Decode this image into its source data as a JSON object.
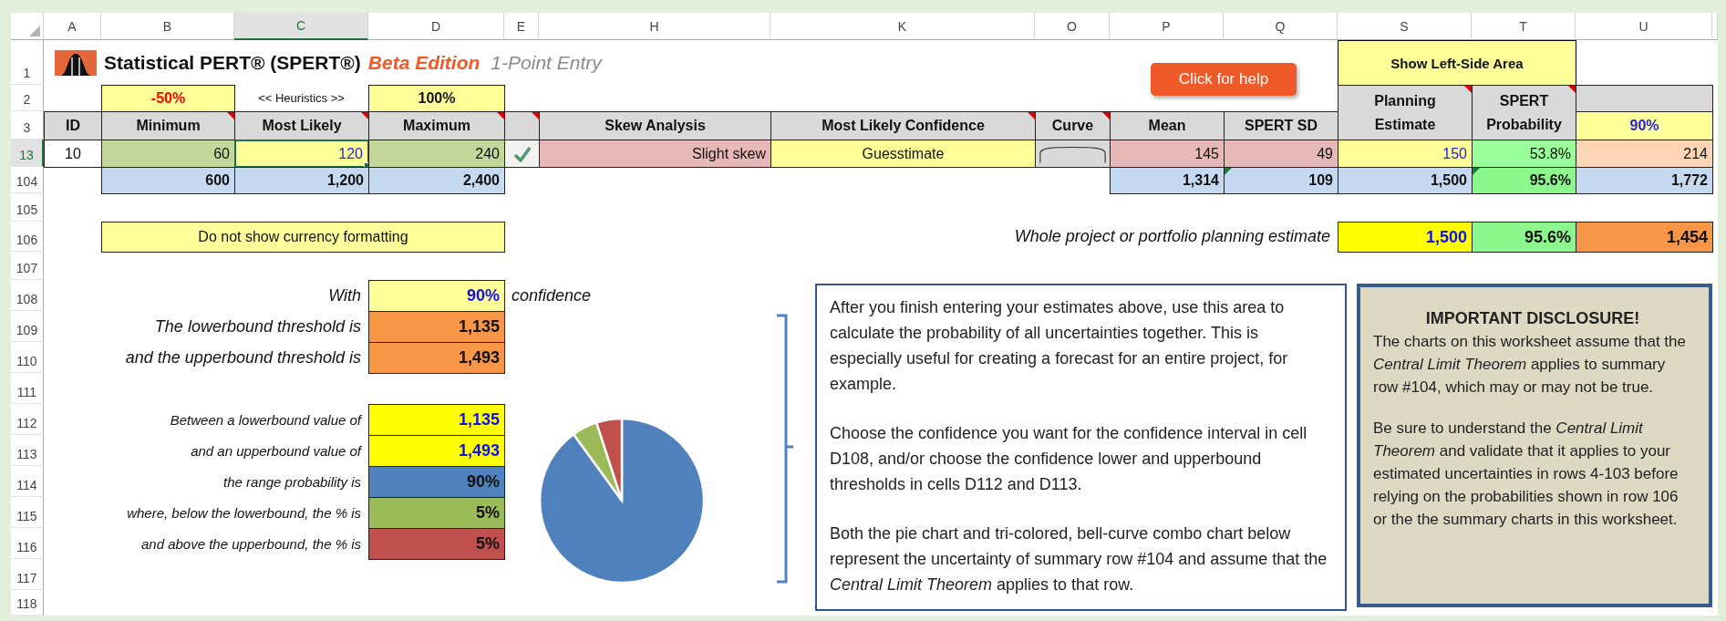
{
  "column_headers": [
    {
      "label": "A",
      "selected": false
    },
    {
      "label": "B",
      "selected": false
    },
    {
      "label": "C",
      "selected": true
    },
    {
      "label": "D",
      "selected": false
    },
    {
      "label": "E",
      "selected": false
    },
    {
      "label": "H",
      "selected": false
    },
    {
      "label": "K",
      "selected": false
    },
    {
      "label": "O",
      "selected": false
    },
    {
      "label": "P",
      "selected": false
    },
    {
      "label": "Q",
      "selected": false
    },
    {
      "label": "S",
      "selected": false
    },
    {
      "label": "T",
      "selected": false
    },
    {
      "label": "U",
      "selected": false
    }
  ],
  "row_headers": [
    {
      "label": "1",
      "selected": false
    },
    {
      "label": "2",
      "selected": false
    },
    {
      "label": "3",
      "selected": false
    },
    {
      "label": "13",
      "selected": true
    },
    {
      "label": "104",
      "selected": false
    },
    {
      "label": "105",
      "selected": false
    },
    {
      "label": "106",
      "selected": false
    },
    {
      "label": "107",
      "selected": false
    },
    {
      "label": "108",
      "selected": false
    },
    {
      "label": "109",
      "selected": false
    },
    {
      "label": "110",
      "selected": false
    },
    {
      "label": "111",
      "selected": false
    },
    {
      "label": "112",
      "selected": false
    },
    {
      "label": "113",
      "selected": false
    },
    {
      "label": "114",
      "selected": false
    },
    {
      "label": "115",
      "selected": false
    },
    {
      "label": "116",
      "selected": false
    },
    {
      "label": "117",
      "selected": false
    },
    {
      "label": "118",
      "selected": false
    }
  ],
  "title": {
    "name": "Statistical PERT® (SPERT®)",
    "edition": "Beta Edition",
    "subtitle": "1-Point Entry"
  },
  "help_button": "Click for help",
  "show_left_button": "Show Left-Side Area",
  "heuristics": {
    "low": "-50%",
    "label": "<< Heuristics >>",
    "high": "100%"
  },
  "headers": [
    {
      "label": "ID",
      "kind": "header",
      "comment": false
    },
    {
      "label": "Minimum",
      "kind": "header",
      "comment": true
    },
    {
      "label": "Most Likely",
      "kind": "header",
      "comment": true
    },
    {
      "label": "Maximum",
      "kind": "header",
      "comment": true
    },
    {
      "kind": "header",
      "comment": true
    },
    {
      "label": "Skew Analysis",
      "kind": "header",
      "comment": false
    },
    {
      "label": "Most Likely Confidence",
      "kind": "header",
      "comment": true
    },
    {
      "label": "Curve",
      "kind": "header",
      "comment": true
    },
    {
      "label": "Mean",
      "kind": "header",
      "comment": false
    },
    {
      "label": "SPERT SD",
      "kind": "header",
      "comment": false
    },
    {
      "label": "Planning Estimate",
      "kind": "tall",
      "comment": true
    },
    {
      "label": "SPERT Probability",
      "kind": "tall",
      "comment": true
    },
    {
      "label": "90%",
      "kind": "input",
      "comment": false
    }
  ],
  "task_row": [
    {
      "kind": "text",
      "text": "10",
      "selected": false
    },
    {
      "kind": "text",
      "text": "60",
      "selected": false
    },
    {
      "kind": "text",
      "text": "120",
      "selected": true
    },
    {
      "kind": "text",
      "text": "240",
      "selected": false
    },
    {
      "kind": "check",
      "selected": false
    },
    {
      "kind": "text",
      "text": "Slight skew",
      "selected": false
    },
    {
      "kind": "text",
      "text": "Guesstimate",
      "selected": false
    },
    {
      "kind": "curve",
      "selected": false
    },
    {
      "kind": "text",
      "text": "145",
      "selected": false
    },
    {
      "kind": "text",
      "text": "49",
      "selected": false
    },
    {
      "kind": "text",
      "text": "150",
      "selected": false
    },
    {
      "kind": "text",
      "text": "53.8%",
      "selected": false
    },
    {
      "kind": "text",
      "text": "214",
      "selected": false
    }
  ],
  "summary_row": [
    {
      "text": "600",
      "warning": false
    },
    {
      "text": "1,200",
      "warning": false
    },
    {
      "text": "2,400",
      "warning": false
    },
    {
      "text": "1,314",
      "warning": false
    },
    {
      "text": "109",
      "warning": true
    },
    {
      "text": "1,500",
      "warning": false
    },
    {
      "text": "95.6%",
      "warning": true
    },
    {
      "text": "1,772",
      "warning": false
    }
  ],
  "currency_toggle": "Do not show currency formatting",
  "whole_project": {
    "label": "Whole project or portfolio planning estimate",
    "cells": [
      "1,500",
      "95.6%",
      "1,454"
    ]
  },
  "confidence": {
    "label": "With",
    "value": "90%",
    "suffix": "confidence"
  },
  "thresholds": [
    {
      "label": "The lowerbound threshold is",
      "value": "1,135"
    },
    {
      "label": "and the upperbound threshold is",
      "value": "1,493"
    }
  ],
  "range_rows": [
    {
      "label": "Between a lowerbound value of",
      "value": "1,135",
      "color": "#ffff00"
    },
    {
      "label": "and an upperbound value of",
      "value": "1,493",
      "color": "#ffff00"
    },
    {
      "label": "the range probability is",
      "value": "90%",
      "color": "#4f81bd"
    },
    {
      "label": "where, below the lowerbound, the % is",
      "value": "5%",
      "color": "#9bbb59"
    },
    {
      "label": "and above the upperbound, the % is",
      "value": "5%",
      "color": "#c0504d"
    }
  ],
  "chart_data": {
    "type": "pie",
    "values": [
      90,
      5,
      5
    ]
  },
  "instructions": [
    "After you finish entering your estimates above, use this area to calculate the probability of all uncertainties together. This is especially useful for creating a forecast for an entire project, for example.",
    "Choose the confidence you want for the confidence interval in cell D108, and/or choose the confidence lower and upperbound thresholds in cells D112 and D113.",
    "Both the pie chart and tri-colored, bell-curve combo chart below represent the uncertainty of summary row #104 and assume that the *Central Limit Theorem* applies to that row."
  ],
  "disclosure": {
    "title": "IMPORTANT DISCLOSURE!",
    "paragraphs": [
      "The charts on this worksheet assume that the *Central Limit Theorem* applies to summary row #104, which may or may not be true.",
      "Be sure to understand the *Central Limit Theorem* and validate that it applies to your estimated uncertainties in rows 4-103 before relying on the probabilities shown in row 106 or the the summary charts in this worksheet."
    ]
  }
}
